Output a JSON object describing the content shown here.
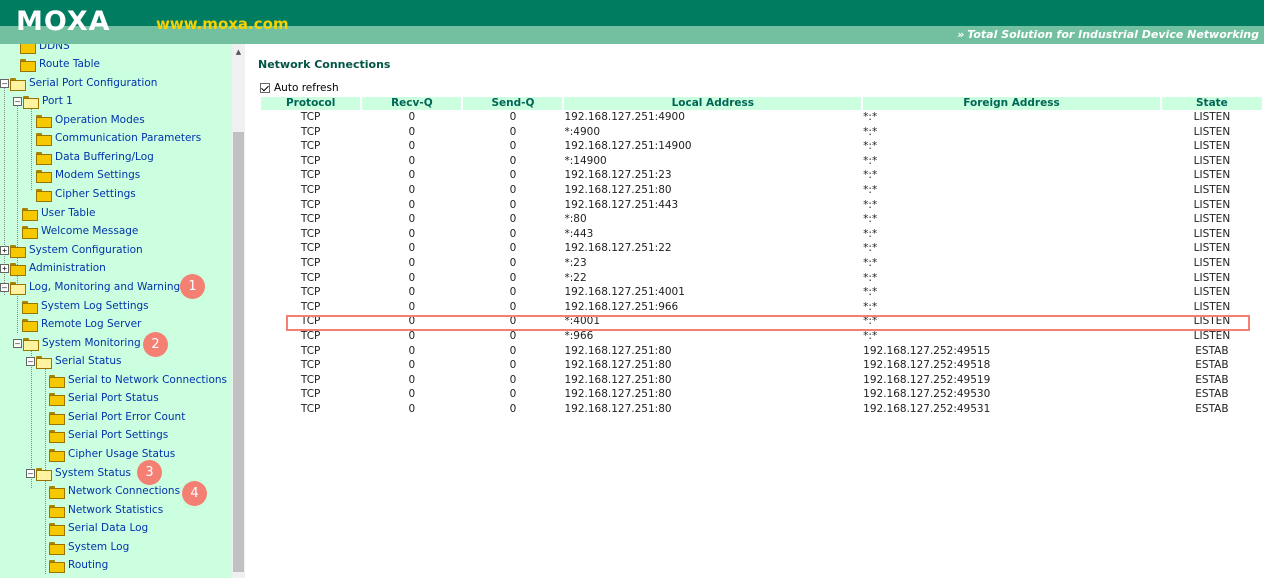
{
  "header": {
    "logo": "MOXA",
    "url": "www.moxa.com",
    "tagline": "Total Solution for Industrial Device Networking",
    "colors": {
      "bar": "#007c60",
      "tagline_bar": "#73c0a0",
      "url": "#f5d200"
    }
  },
  "sidebar": {
    "items": [
      {
        "label": "DDNS"
      },
      {
        "label": "Route Table"
      },
      {
        "label": "Serial Port Configuration"
      },
      {
        "label": "Port 1"
      },
      {
        "label": "Operation Modes"
      },
      {
        "label": "Communication Parameters"
      },
      {
        "label": "Data Buffering/Log"
      },
      {
        "label": "Modem Settings"
      },
      {
        "label": "Cipher Settings"
      },
      {
        "label": "User Table"
      },
      {
        "label": "Welcome Message"
      },
      {
        "label": "System Configuration"
      },
      {
        "label": "Administration"
      },
      {
        "label": "Log, Monitoring and Warning"
      },
      {
        "label": "System Log Settings"
      },
      {
        "label": "Remote Log Server"
      },
      {
        "label": "System Monitoring"
      },
      {
        "label": "Serial Status"
      },
      {
        "label": "Serial to Network Connections"
      },
      {
        "label": "Serial Port Status"
      },
      {
        "label": "Serial Port Error Count"
      },
      {
        "label": "Serial Port Settings"
      },
      {
        "label": "Cipher Usage Status"
      },
      {
        "label": "System Status"
      },
      {
        "label": "Network Connections"
      },
      {
        "label": "Network Statistics"
      },
      {
        "label": "Serial Data Log"
      },
      {
        "label": "System Log"
      },
      {
        "label": "Routing"
      }
    ],
    "badges": [
      "1",
      "2",
      "3",
      "4"
    ]
  },
  "main": {
    "title": "Network Connections",
    "auto_refresh_label": "Auto refresh",
    "auto_refresh_checked": true,
    "columns": [
      "Protocol",
      "Recv-Q",
      "Send-Q",
      "Local Address",
      "Foreign Address",
      "State"
    ],
    "rows": [
      [
        "TCP",
        "0",
        "0",
        "192.168.127.251:4900",
        "*:*",
        "LISTEN"
      ],
      [
        "TCP",
        "0",
        "0",
        "*:4900",
        "*:*",
        "LISTEN"
      ],
      [
        "TCP",
        "0",
        "0",
        "192.168.127.251:14900",
        "*:*",
        "LISTEN"
      ],
      [
        "TCP",
        "0",
        "0",
        "*:14900",
        "*:*",
        "LISTEN"
      ],
      [
        "TCP",
        "0",
        "0",
        "192.168.127.251:23",
        "*:*",
        "LISTEN"
      ],
      [
        "TCP",
        "0",
        "0",
        "192.168.127.251:80",
        "*:*",
        "LISTEN"
      ],
      [
        "TCP",
        "0",
        "0",
        "192.168.127.251:443",
        "*:*",
        "LISTEN"
      ],
      [
        "TCP",
        "0",
        "0",
        "*:80",
        "*:*",
        "LISTEN"
      ],
      [
        "TCP",
        "0",
        "0",
        "*:443",
        "*:*",
        "LISTEN"
      ],
      [
        "TCP",
        "0",
        "0",
        "192.168.127.251:22",
        "*:*",
        "LISTEN"
      ],
      [
        "TCP",
        "0",
        "0",
        "*:23",
        "*:*",
        "LISTEN"
      ],
      [
        "TCP",
        "0",
        "0",
        "*:22",
        "*:*",
        "LISTEN"
      ],
      [
        "TCP",
        "0",
        "0",
        "192.168.127.251:4001",
        "*:*",
        "LISTEN"
      ],
      [
        "TCP",
        "0",
        "0",
        "192.168.127.251:966",
        "*:*",
        "LISTEN"
      ],
      [
        "TCP",
        "0",
        "0",
        "*:4001",
        "*:*",
        "LISTEN"
      ],
      [
        "TCP",
        "0",
        "0",
        "*:966",
        "*:*",
        "LISTEN"
      ],
      [
        "TCP",
        "0",
        "0",
        "192.168.127.251:80",
        "192.168.127.252:49515",
        "ESTAB"
      ],
      [
        "TCP",
        "0",
        "0",
        "192.168.127.251:80",
        "192.168.127.252:49518",
        "ESTAB"
      ],
      [
        "TCP",
        "0",
        "0",
        "192.168.127.251:80",
        "192.168.127.252:49519",
        "ESTAB"
      ],
      [
        "TCP",
        "0",
        "0",
        "192.168.127.251:80",
        "192.168.127.252:49530",
        "ESTAB"
      ],
      [
        "TCP",
        "0",
        "0",
        "192.168.127.251:80",
        "192.168.127.252:49531",
        "ESTAB"
      ]
    ],
    "highlighted_row": 14,
    "highlight_color": "#f48074"
  }
}
